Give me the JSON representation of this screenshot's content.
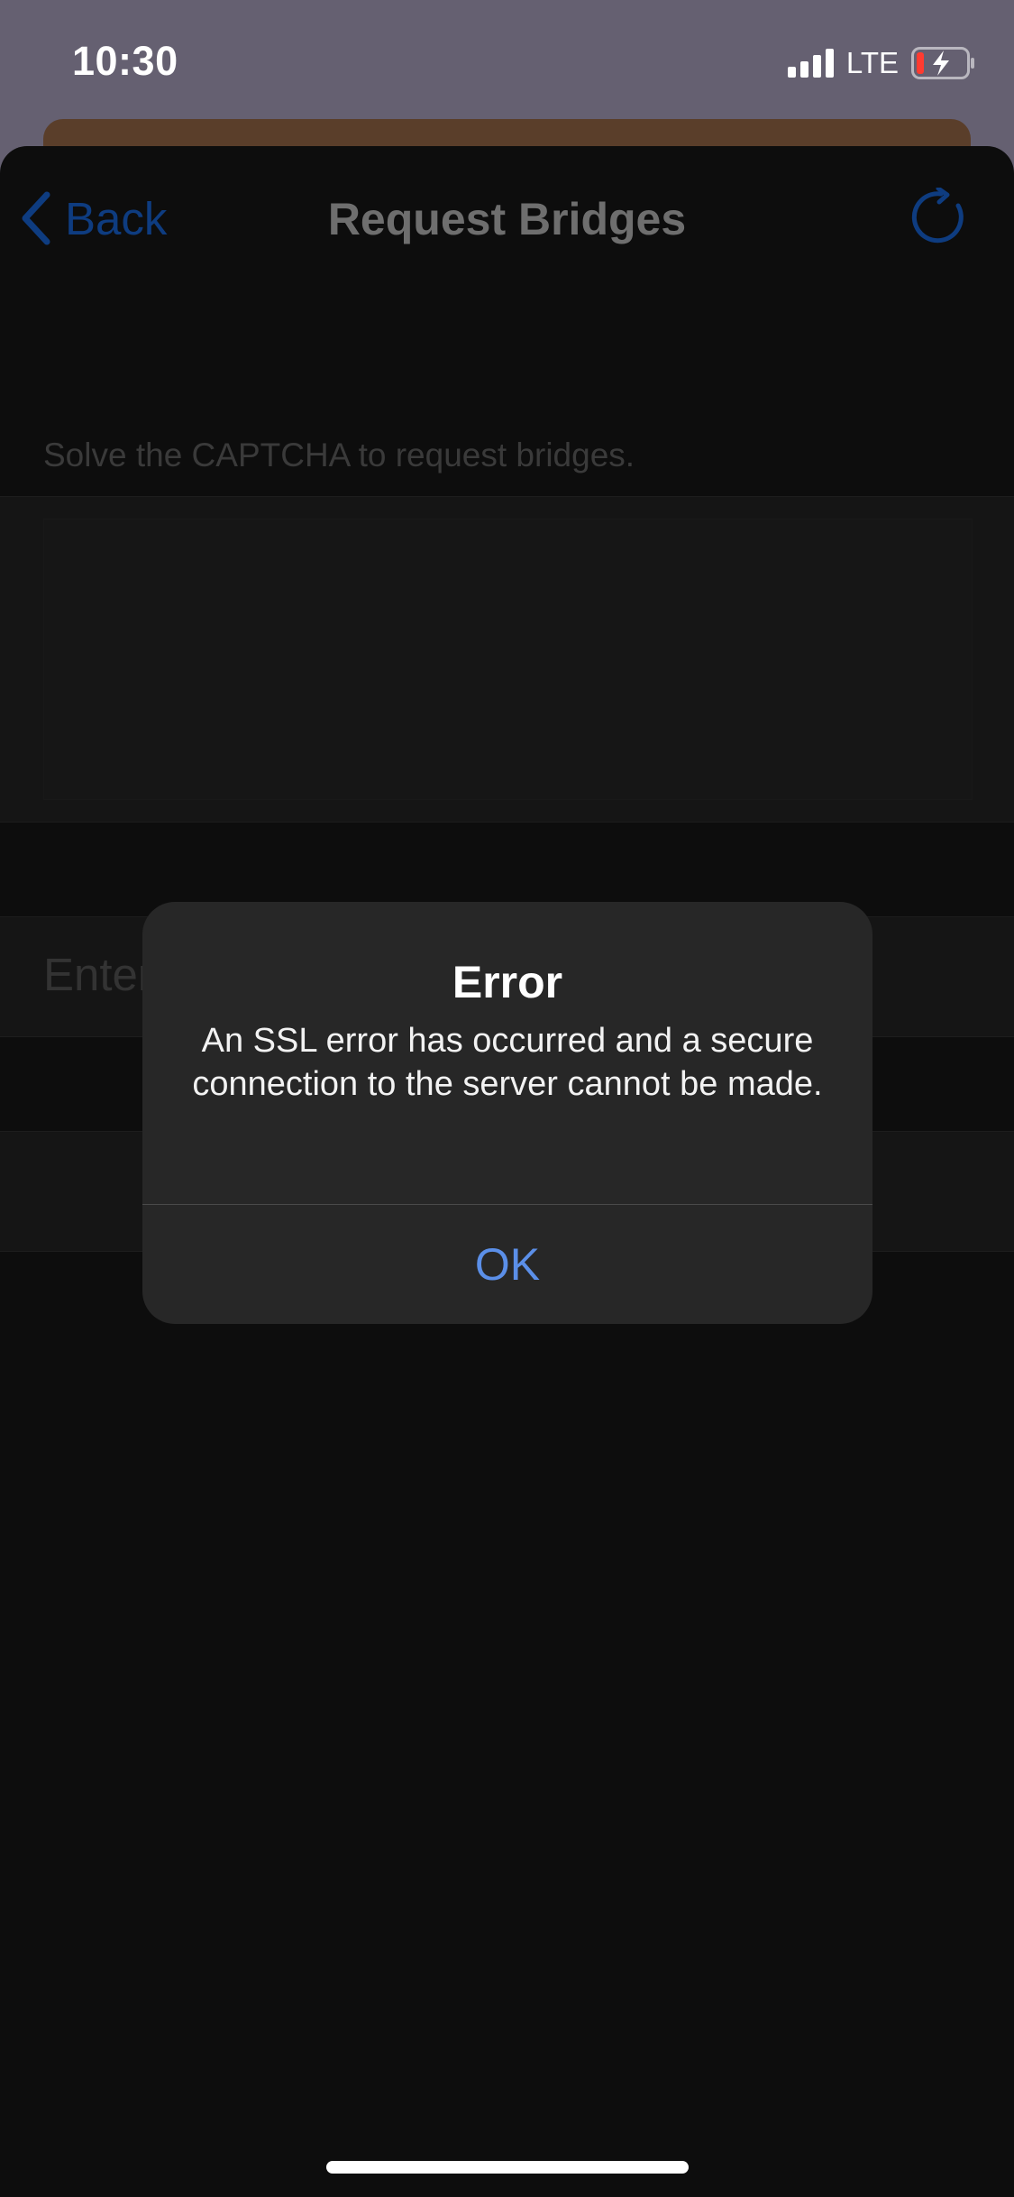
{
  "status_bar": {
    "time": "10:30",
    "network": "LTE",
    "battery_state": "low-charging"
  },
  "nav": {
    "back_label": "Back",
    "title": "Request Bridges",
    "refresh_icon": "refresh-icon"
  },
  "content": {
    "section_header": "Solve the CAPTCHA to request bridges.",
    "input_placeholder": "Enter"
  },
  "alert": {
    "title": "Error",
    "message": "An SSL error has occurred and a secure connection to the server cannot be made.",
    "ok_label": "OK"
  },
  "colors": {
    "accent": "#5b8fe8",
    "dimmed_accent": "#0e3c80",
    "backdrop": "#656071",
    "sheet": "#0d0d0d"
  }
}
